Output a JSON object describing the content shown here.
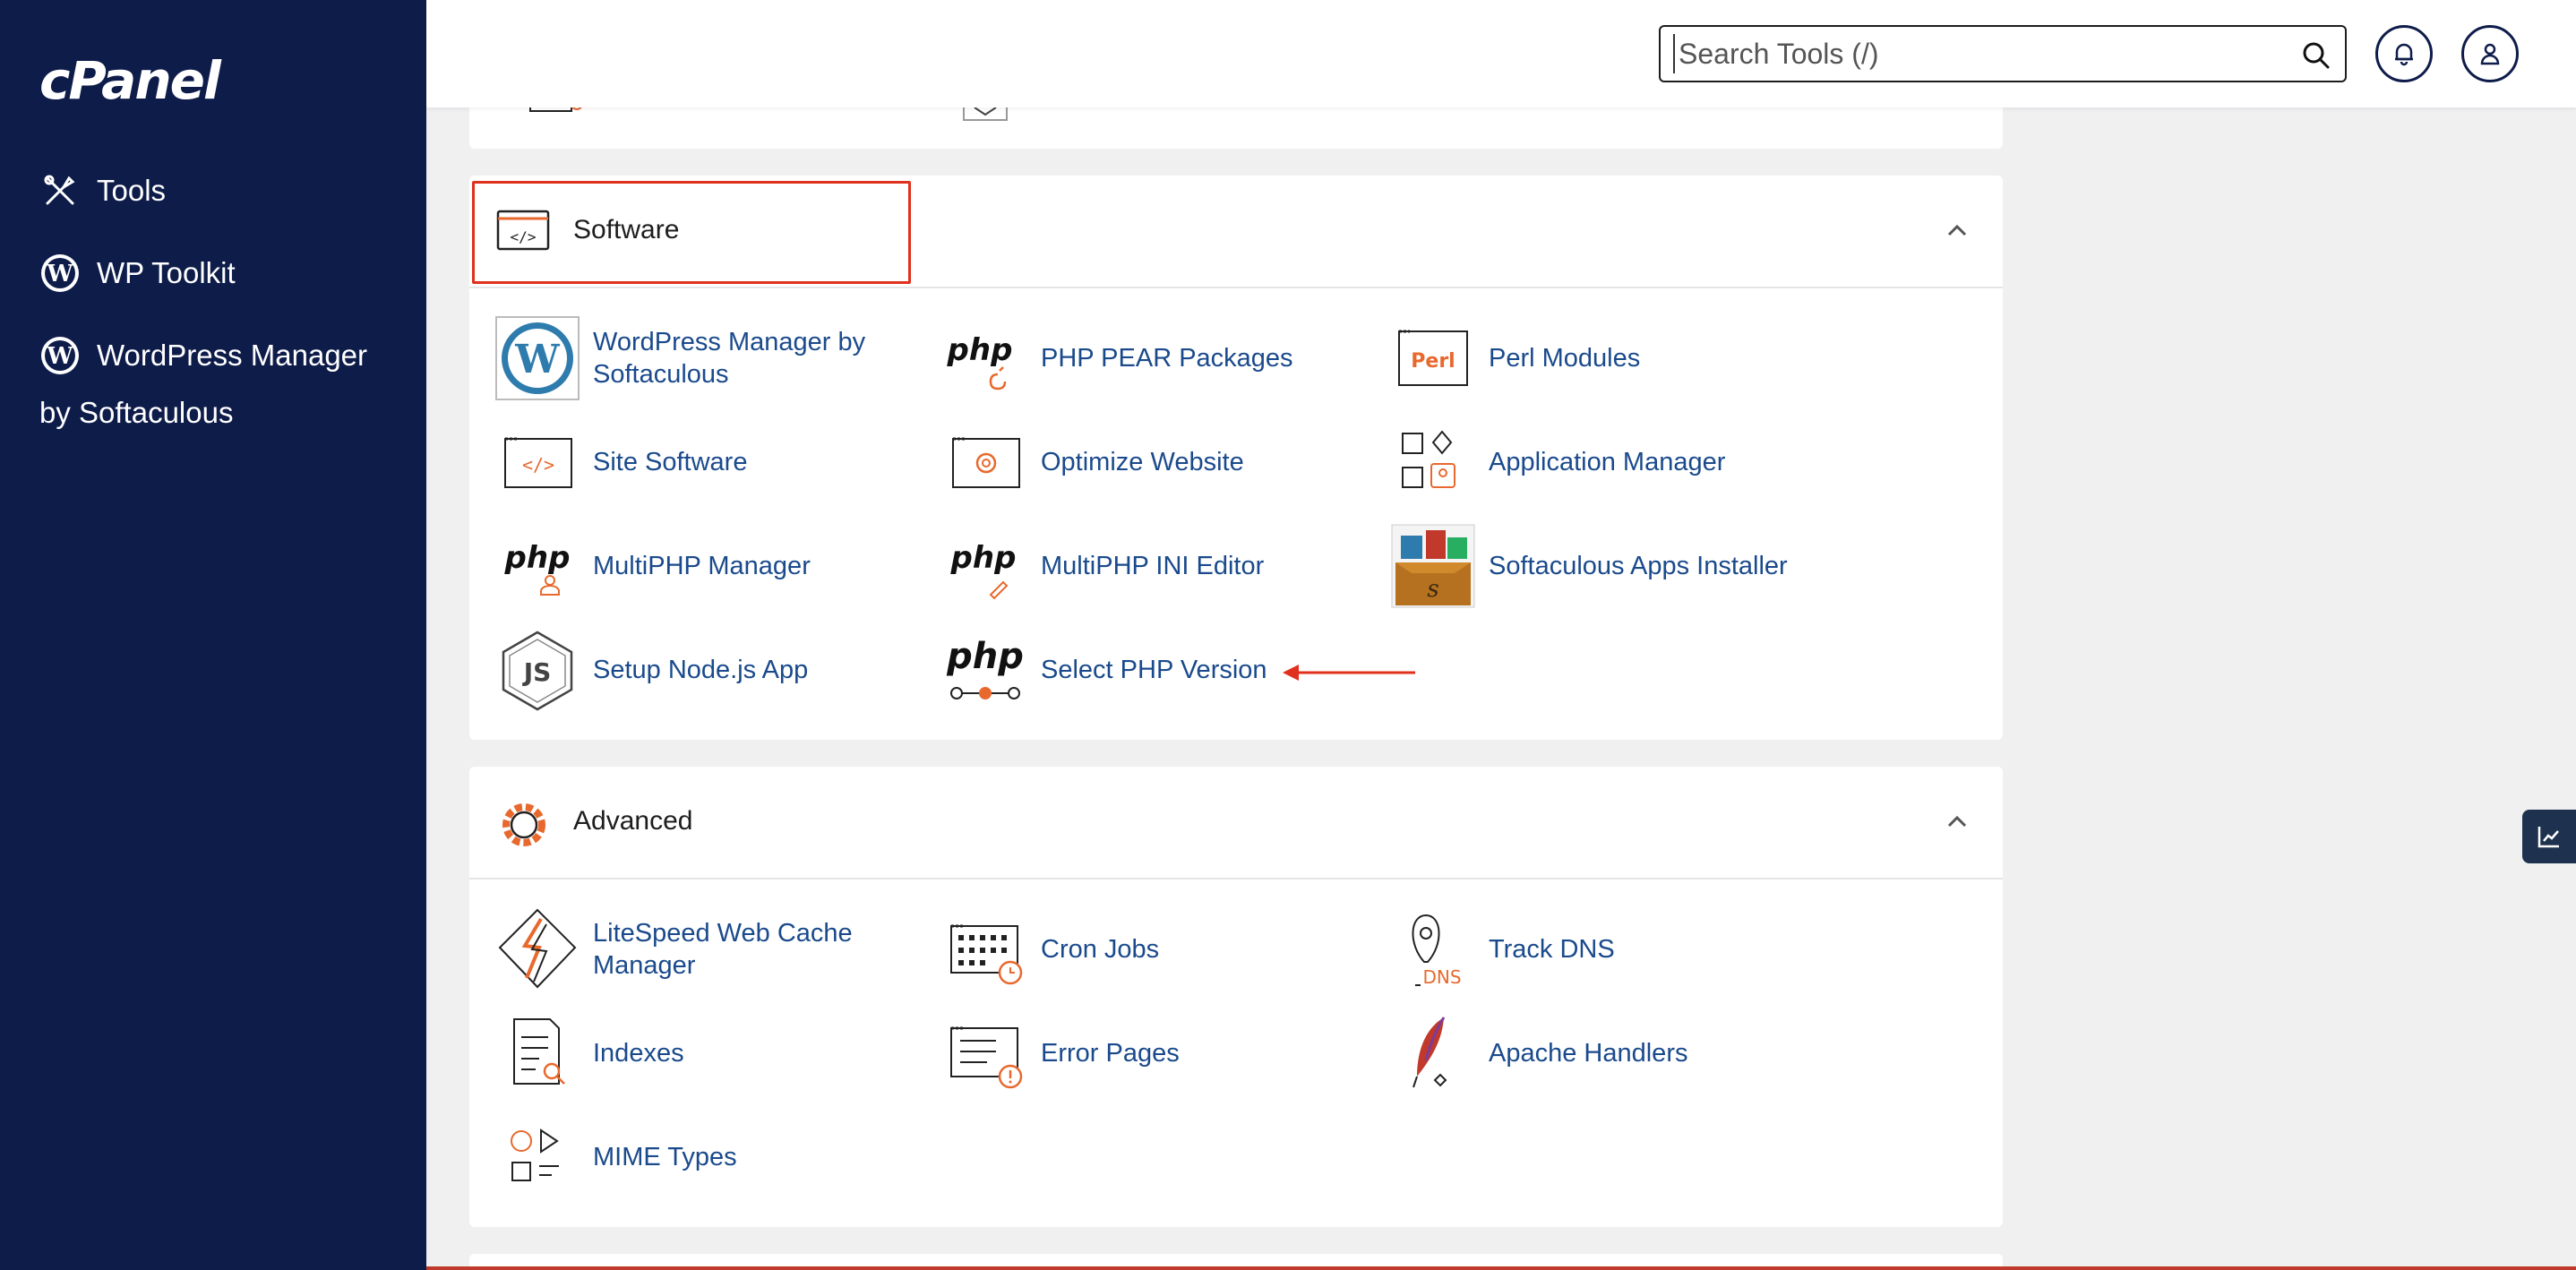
{
  "app": {
    "logo": "cPanel"
  },
  "sidebar": {
    "items": [
      {
        "label": "Tools",
        "icon": "tools-icon"
      },
      {
        "label": "WP Toolkit",
        "icon": "wordpress-icon"
      },
      {
        "label_line1": "WordPress Manager",
        "label_line2": "by Softaculous",
        "icon": "wordpress-icon"
      }
    ]
  },
  "header": {
    "search_placeholder": "Search Tools (/)",
    "search_icon": "search-icon",
    "bell_icon": "bell-icon",
    "user_icon": "user-icon"
  },
  "software": {
    "title": "Software",
    "items": [
      {
        "label": "WordPress Manager by Softaculous",
        "icon": "wordpress-logo-icon"
      },
      {
        "label": "PHP PEAR Packages",
        "icon": "php-pear-icon"
      },
      {
        "label": "Perl Modules",
        "icon": "perl-icon",
        "badge": "Perl"
      },
      {
        "label": "Site Software",
        "icon": "code-window-icon"
      },
      {
        "label": "Optimize Website",
        "icon": "optimize-icon"
      },
      {
        "label": "Application Manager",
        "icon": "app-manager-icon"
      },
      {
        "label": "MultiPHP Manager",
        "icon": "php-user-icon"
      },
      {
        "label": "MultiPHP INI Editor",
        "icon": "php-edit-icon"
      },
      {
        "label": "Softaculous Apps Installer",
        "icon": "softaculous-icon"
      },
      {
        "label": "Setup Node.js App",
        "icon": "nodejs-icon"
      },
      {
        "label": "Select PHP Version",
        "icon": "php-version-icon"
      }
    ],
    "php_text": "php"
  },
  "advanced": {
    "title": "Advanced",
    "items": [
      {
        "label": "LiteSpeed Web Cache Manager",
        "icon": "litespeed-icon"
      },
      {
        "label": "Cron Jobs",
        "icon": "cron-icon"
      },
      {
        "label": "Track DNS",
        "icon": "track-dns-icon",
        "badge": "DNS"
      },
      {
        "label": "Indexes",
        "icon": "indexes-icon"
      },
      {
        "label": "Error Pages",
        "icon": "error-pages-icon"
      },
      {
        "label": "Apache Handlers",
        "icon": "apache-feather-icon"
      },
      {
        "label": "MIME Types",
        "icon": "mime-types-icon"
      }
    ]
  },
  "colors": {
    "sidebar_bg": "#0e1c4a",
    "link": "#1a4a8c",
    "accent_orange": "#e8692e",
    "highlight_red": "#e0301e"
  }
}
